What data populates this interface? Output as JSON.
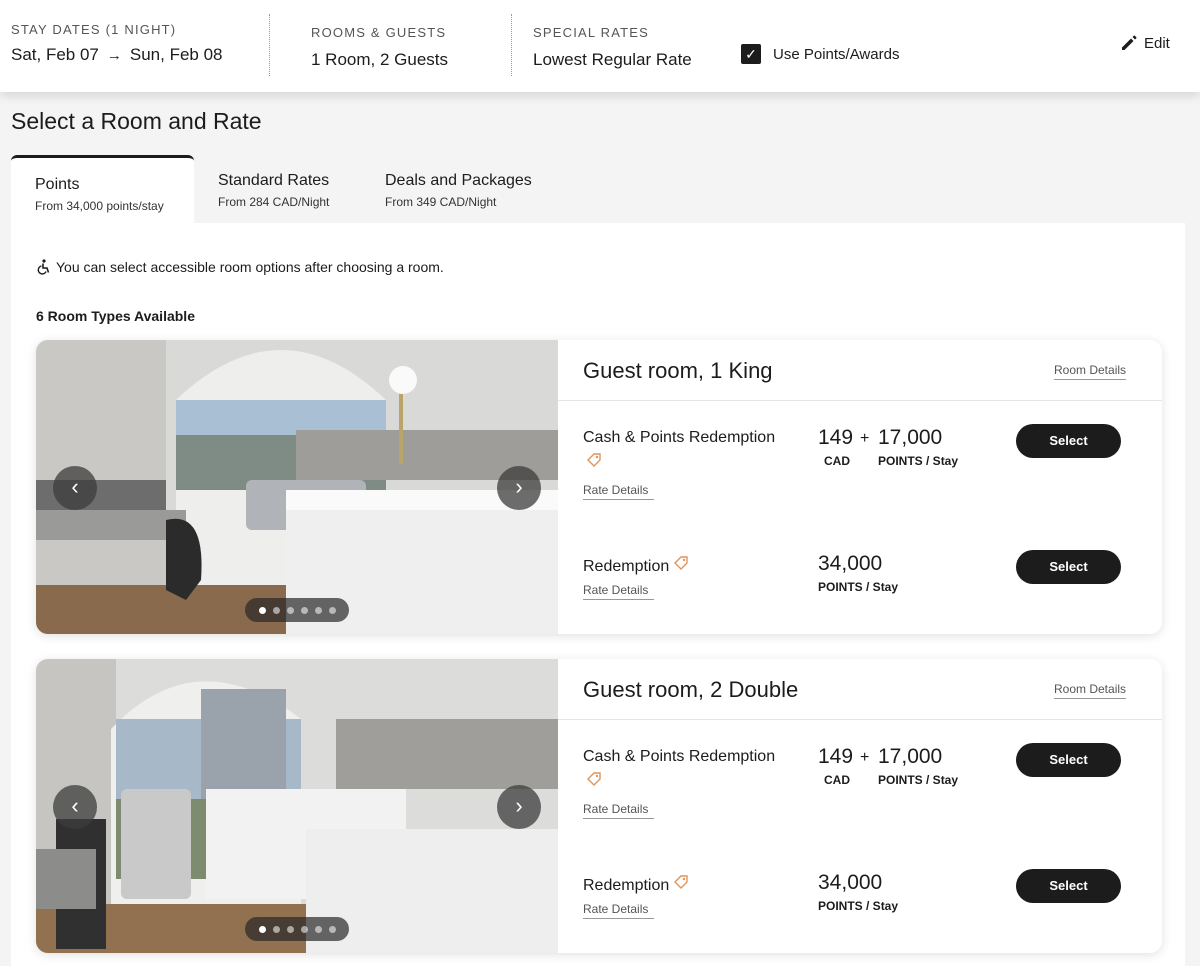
{
  "header": {
    "stay_label": "STAY DATES (1 NIGHT)",
    "check_in": "Sat, Feb 07",
    "arrow": "→",
    "check_out": "Sun, Feb 08",
    "rooms_label": "ROOMS & GUESTS",
    "rooms_value": "1 Room, 2 Guests",
    "rates_label": "SPECIAL RATES",
    "rates_value": "Lowest Regular Rate",
    "use_points_label": "Use Points/Awards",
    "use_points_checked": true,
    "edit_label": "Edit"
  },
  "page_title": "Select a Room and Rate",
  "tabs": [
    {
      "title": "Points",
      "subtitle": "From 34,000 points/stay",
      "active": true
    },
    {
      "title": "Standard Rates",
      "subtitle": "From 284 CAD/Night",
      "active": false
    },
    {
      "title": "Deals and Packages",
      "subtitle": "From 349 CAD/Night",
      "active": false
    }
  ],
  "accessibility_note": "You can select accessible room options after choosing a room.",
  "room_count": "6 Room Types Available",
  "rooms": [
    {
      "name": "Guest room, 1 King",
      "details_link": "Room Details",
      "rates": [
        {
          "name": "Cash & Points Redemption",
          "link": "Rate Details",
          "cash": "149",
          "plus": "+",
          "cash_unit": "CAD",
          "points": "17,000",
          "points_unit": "POINTS",
          "per": "/ Stay",
          "button": "Select"
        },
        {
          "name": "Redemption",
          "link": "Rate Details",
          "points": "34,000",
          "points_unit": "POINTS",
          "per": "/ Stay",
          "button": "Select"
        }
      ]
    },
    {
      "name": "Guest room, 2 Double",
      "details_link": "Room Details",
      "rates": [
        {
          "name": "Cash & Points Redemption",
          "link": "Rate Details",
          "cash": "149",
          "plus": "+",
          "cash_unit": "CAD",
          "points": "17,000",
          "points_unit": "POINTS",
          "per": "/ Stay",
          "button": "Select"
        },
        {
          "name": "Redemption",
          "link": "Rate Details",
          "points": "34,000",
          "points_unit": "POINTS",
          "per": "/ Stay",
          "button": "Select"
        }
      ]
    }
  ],
  "icons": {
    "check": "✓",
    "edit": "pencil-icon",
    "prev": "‹",
    "next": "›",
    "tag": "tag-icon",
    "accessible": "wheelchair-icon"
  }
}
